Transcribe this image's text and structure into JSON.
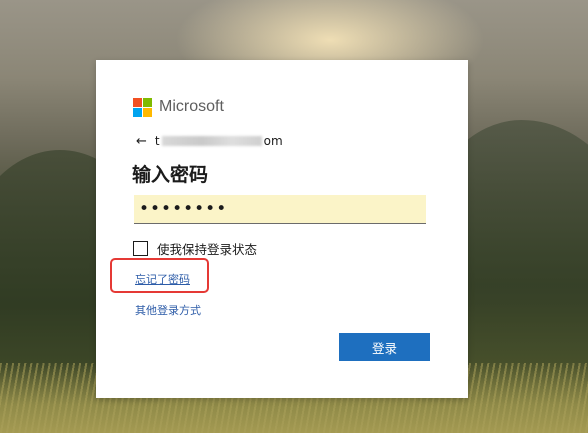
{
  "brand": {
    "name": "Microsoft",
    "logo_colors": [
      "#f25022",
      "#7fba00",
      "#00a4ef",
      "#ffb900"
    ]
  },
  "identity": {
    "back_icon": "arrow-left-icon",
    "email_prefix": "t",
    "email_suffix": "om"
  },
  "heading": "输入密码",
  "password": {
    "value": "••••••••"
  },
  "keep_signed_in": {
    "label": "使我保持登录状态",
    "checked": false
  },
  "links": {
    "forgot_password": "忘记了密码",
    "other_signin": "其他登录方式"
  },
  "annotation": {
    "color": "#e53935"
  },
  "signin_button": {
    "label": "登录",
    "color": "#1e6fbf"
  }
}
